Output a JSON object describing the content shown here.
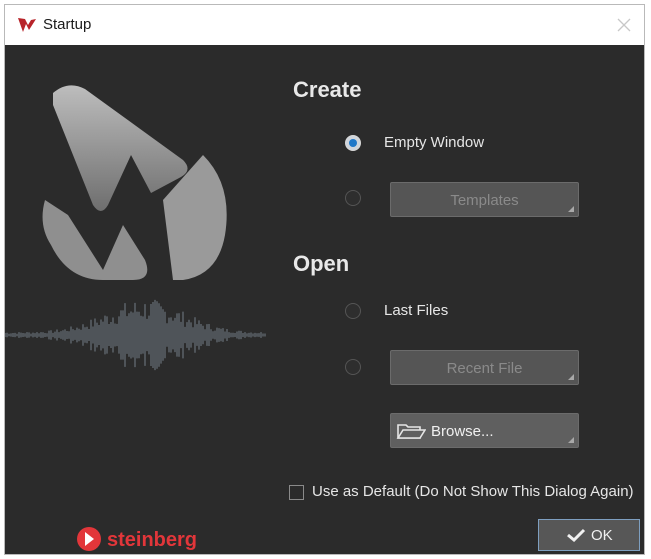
{
  "window": {
    "title": "Startup",
    "icon": "wavelab-icon"
  },
  "create": {
    "heading": "Create",
    "empty_window_label": "Empty Window",
    "empty_window_selected": true,
    "templates_label": "Templates"
  },
  "open": {
    "heading": "Open",
    "last_files_label": "Last Files",
    "recent_file_label": "Recent File",
    "browse_label": "Browse..."
  },
  "default_checkbox": {
    "label": "Use as Default (Do Not Show This Dialog Again)",
    "checked": false
  },
  "brand": {
    "text": "steinberg",
    "color": "#e2363a"
  },
  "ok_button": {
    "label": "OK"
  },
  "colors": {
    "accent": "#1f78c8",
    "background": "#2b2b2b",
    "button": "#5b5b5b"
  }
}
